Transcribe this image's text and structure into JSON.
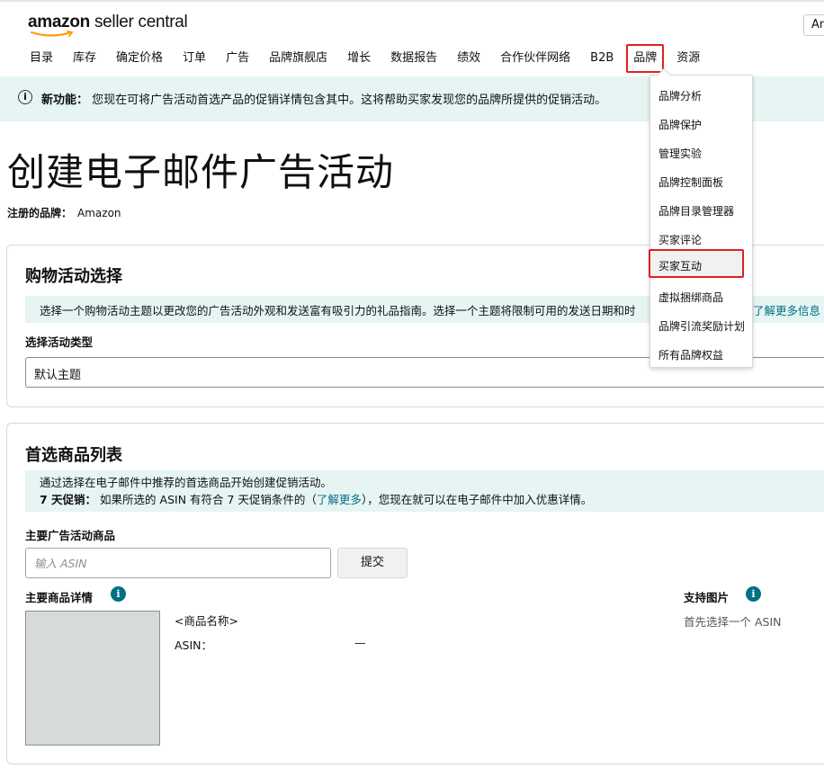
{
  "header": {
    "logo_brand": "amazon",
    "logo_product": "seller central",
    "language_btn": "An"
  },
  "nav": {
    "items": [
      "目录",
      "库存",
      "确定价格",
      "订单",
      "广告",
      "品牌旗舰店",
      "增长",
      "数据报告",
      "绩效",
      "合作伙伴网络",
      "B2B",
      "品牌",
      "资源"
    ],
    "highlighted": "品牌"
  },
  "banner": {
    "icon": "info-icon",
    "title": "新功能：",
    "message": "您现在可将广告活动首选产品的促销详情包含其中。这将帮助买家发现您的品牌所提供的促销活动。"
  },
  "page": {
    "title": "创建电子邮件广告活动",
    "brand_label": "注册的品牌：",
    "brand_value": "Amazon"
  },
  "shopping": {
    "title": "购物活动选择",
    "tip_text": "选择一个购物活动主题以更改您的广告活动外观和发送富有吸引力的礼品指南。选择一个主题将限制可用的发送日期和时",
    "tip_link": "了解更多信息",
    "type_label": "选择活动类型",
    "type_value": "默认主题"
  },
  "products": {
    "title": "首选商品列表",
    "tip_line1": "通过选择在电子邮件中推荐的首选商品开始创建促销活动。",
    "tip_line2_bold": "7 天促销：",
    "tip_line2_before": "如果所选的 ASIN 有符合 7 天促销条件的（",
    "tip_line2_link": "了解更多",
    "tip_line2_after": "），您现在就可以在电子邮件中加入优惠详情。",
    "main_label": "主要广告活动商品",
    "asin_placeholder": "输入 ASIN",
    "submit_label": "提交",
    "details_label": "主要商品详情",
    "product_name": "<商品名称>",
    "asin_label": "ASIN：",
    "asin_value": "—",
    "support_label": "支持图片",
    "support_hint": "首先选择一个 ASIN"
  },
  "brand_menu": {
    "items": [
      "品牌分析",
      "品牌保护",
      "管理实验",
      "品牌控制面板",
      "品牌目录管理器",
      "买家评论",
      "买家互动",
      "虚拟捆绑商品",
      "品牌引流奖励计划",
      "所有品牌权益"
    ],
    "highlighted": "买家互动"
  }
}
